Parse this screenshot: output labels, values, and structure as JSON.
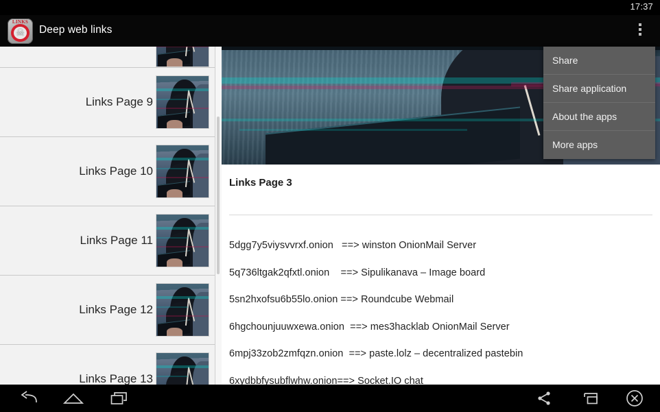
{
  "status_bar": {
    "clock": "17:37"
  },
  "action_bar": {
    "app_title": "Deep web links",
    "app_icon_word": "LINKS",
    "app_icon_name": "skull-links-app-icon",
    "overflow_icon": "overflow-menu-icon"
  },
  "overflow_menu": {
    "items": [
      {
        "label": "Share"
      },
      {
        "label": "Share application"
      },
      {
        "label": "About the apps"
      },
      {
        "label": "More apps"
      }
    ]
  },
  "sidebar": {
    "rows": [
      {
        "label": "",
        "partial": true
      },
      {
        "label": "Links Page 9"
      },
      {
        "label": "Links Page 10"
      },
      {
        "label": "Links Page 11"
      },
      {
        "label": "Links Page 12"
      },
      {
        "label": "Links Page 13"
      }
    ]
  },
  "content": {
    "hero_image_name": "hacker-hooded-figure-banner",
    "title": "Links Page 3",
    "links": [
      "5dgg7y5viysvvrxf.onion   ==> winston OnionMail Server",
      "5q736ltgak2qfxtl.onion    ==> Sipulikanava – Image board",
      "5sn2hxofsu6b55lo.onion ==> Roundcube Webmail",
      "6hgchounjuuwxewa.onion  ==> mes3hacklab OnionMail Server",
      "6mpj33zob2zmfqzn.onion  ==> paste.lolz – decentralized pastebin",
      "6xydbbfysubflwhw.onion==> Socket.IO chat"
    ]
  },
  "navbar": {
    "back_label": "Back",
    "home_label": "Home",
    "recent_label": "Recent apps",
    "share_label": "Share",
    "pip_label": "Picture in picture",
    "close_label": "Close"
  },
  "colors": {
    "bar_background": "#000000",
    "list_background": "#f2f2f2",
    "content_background": "#ffffff",
    "menu_background": "#5d5d5d",
    "icon_accent_red": "#d4202e"
  }
}
